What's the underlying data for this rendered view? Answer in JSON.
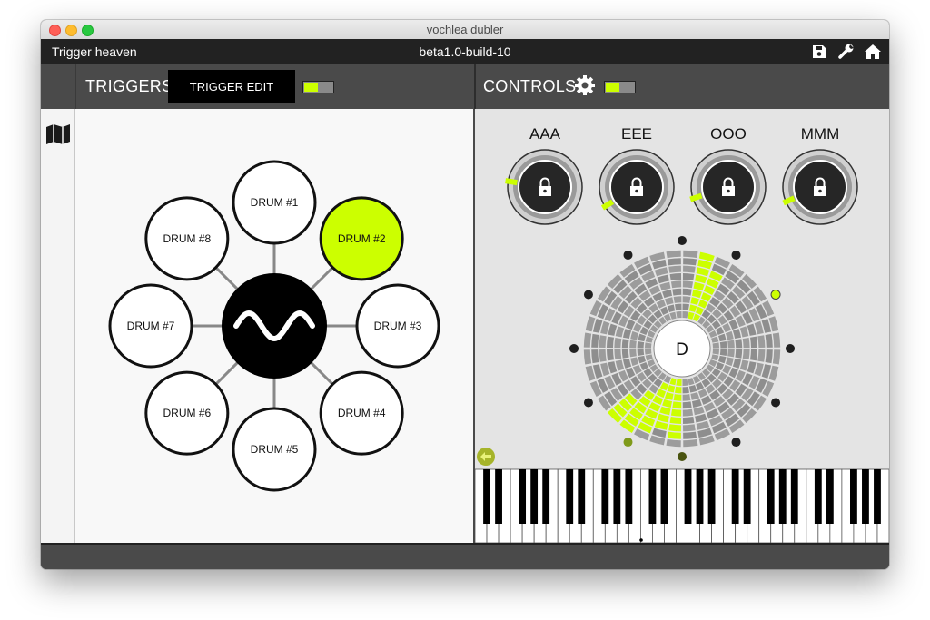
{
  "window": {
    "title": "vochlea dubler"
  },
  "appbar": {
    "preset": "Trigger heaven",
    "build": "beta1.0-build-10",
    "icons": [
      "save-icon",
      "wrench-icon",
      "home-icon"
    ]
  },
  "triggers": {
    "header": "TRIGGERS",
    "edit_button": "TRIGGER EDIT",
    "toggle_on": true,
    "hub_icon": "waveform-icon",
    "drums": [
      {
        "label": "DRUM #1",
        "active": false
      },
      {
        "label": "DRUM #2",
        "active": true
      },
      {
        "label": "DRUM #3",
        "active": false
      },
      {
        "label": "DRUM #4",
        "active": false
      },
      {
        "label": "DRUM #5",
        "active": false
      },
      {
        "label": "DRUM #6",
        "active": false
      },
      {
        "label": "DRUM #7",
        "active": false
      },
      {
        "label": "DRUM #8",
        "active": false
      }
    ]
  },
  "controls": {
    "header": "CONTROLS",
    "settings_icon": "gear-icon",
    "toggle_on": true,
    "knobs": [
      {
        "label": "AAA",
        "value": 0.2,
        "icon": "lock-icon"
      },
      {
        "label": "EEE",
        "value": 0.05,
        "icon": "lock-icon"
      },
      {
        "label": "OOO",
        "value": 0.1,
        "icon": "lock-icon"
      },
      {
        "label": "MMM",
        "value": 0.08,
        "icon": "lock-icon"
      }
    ],
    "pitch_wheel": {
      "note": "D",
      "rings": 9,
      "segments": 36,
      "accent": "#ccff00"
    },
    "keyboard": {
      "white_keys": 35,
      "back_icon": "arrow-left-icon"
    }
  },
  "sidebar": {
    "icon": "map-icon"
  },
  "colors": {
    "accent": "#ccff00",
    "dark": "#222222",
    "panel": "#4a4a4a"
  }
}
